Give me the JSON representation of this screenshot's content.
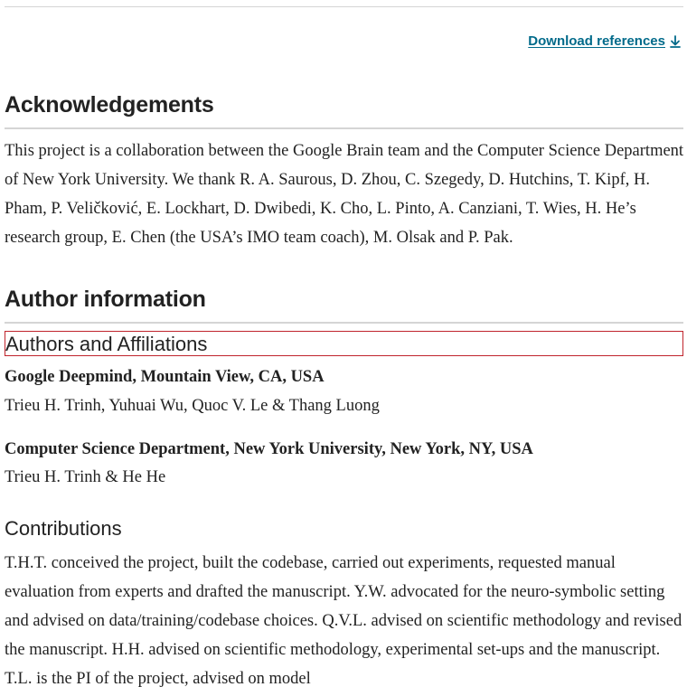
{
  "download": {
    "label": "Download references",
    "icon": "download-arrow-icon",
    "color": "#006a8a"
  },
  "acknowledgements": {
    "heading": "Acknowledgements",
    "text": "This project is a collaboration between the Google Brain team and the Computer Science Department of New York University. We thank R. A. Saurous, D. Zhou, C. Szegedy, D. Hutchins, T. Kipf, H. Pham, P. Veličković, E. Lockhart, D. Dwibedi, K. Cho, L. Pinto, A. Canziani, T. Wies, H. He’s research group, E. Chen (the USA’s IMO team coach), M. Olsak and P. Pak."
  },
  "author_information": {
    "heading": "Author information",
    "affiliations_heading": "Authors and Affiliations",
    "affiliations": [
      {
        "name": "Google Deepmind, Mountain View, CA, USA",
        "authors": "Trieu H. Trinh, Yuhuai Wu, Quoc V. Le & Thang Luong"
      },
      {
        "name": "Computer Science Department, New York University, New York, NY, USA",
        "authors": "Trieu H. Trinh & He He"
      }
    ],
    "contributions_heading": "Contributions",
    "contributions_text": "T.H.T. conceived the project, built the codebase, carried out experiments, requested manual evaluation from experts and drafted the manuscript. Y.W. advocated for the neuro-symbolic setting and advised on data/training/codebase choices. Q.V.L. advised on scientific methodology and revised the manuscript. H.H. advised on scientific methodology, experimental set-ups and the manuscript. T.L. is the PI of the project, advised on model"
  },
  "colors": {
    "text": "#222222",
    "rule": "#d5d5d5",
    "highlight_border": "#c0242c"
  }
}
